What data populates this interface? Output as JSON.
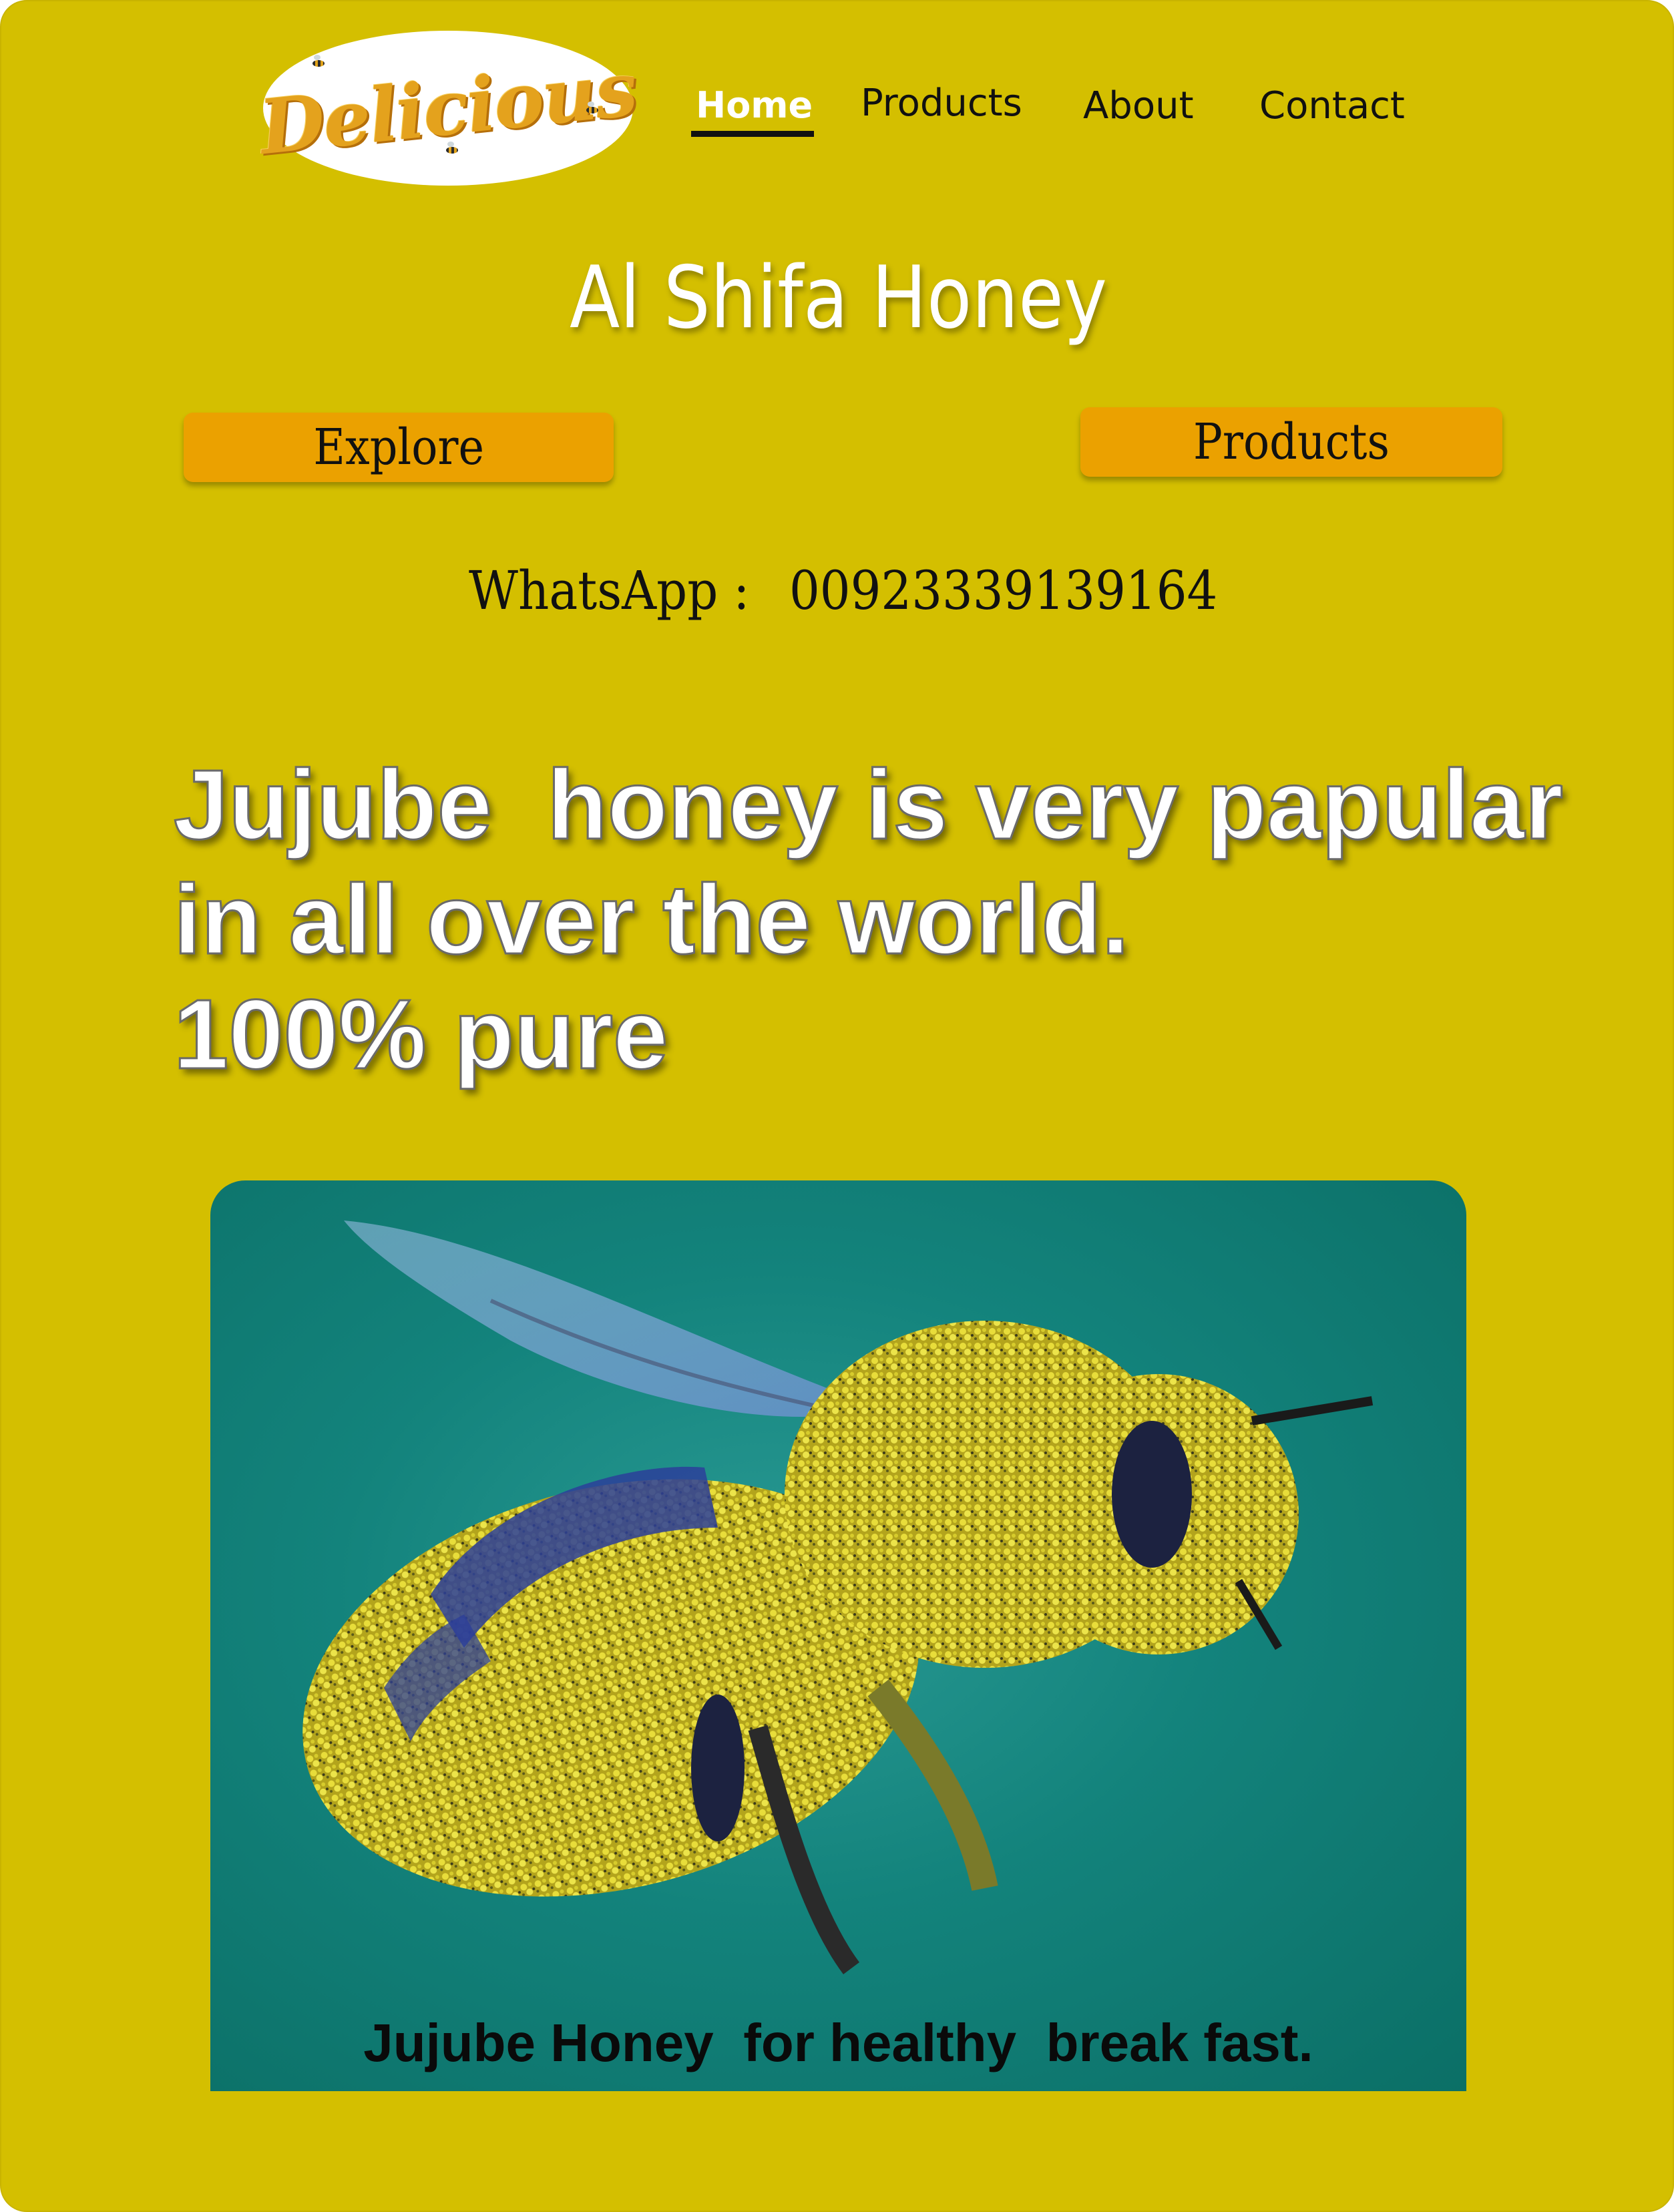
{
  "logo": {
    "text": "Delicious",
    "icon": "bee-icon"
  },
  "nav": {
    "items": [
      {
        "label": "Home",
        "active": true
      },
      {
        "label": "Products",
        "active": false
      },
      {
        "label": "About",
        "active": false
      },
      {
        "label": "Contact",
        "active": false
      }
    ]
  },
  "hero": {
    "title": "Al Shifa Honey",
    "explore_label": "Explore",
    "products_label": "Products",
    "whatsapp_label": "WhatsApp :",
    "whatsapp_number": "00923339139164"
  },
  "headline": "Jujube  honey is very papular\nin all over the world.\n100% pure",
  "image": {
    "subject": "bee covered in pollen",
    "caption": "Jujube Honey  for healthy  break fast."
  },
  "colors": {
    "page_bg": "#d4bf00",
    "button_bg": "#eba100",
    "logo_text": "#e4a21d",
    "photo_bg": "#13837c"
  }
}
